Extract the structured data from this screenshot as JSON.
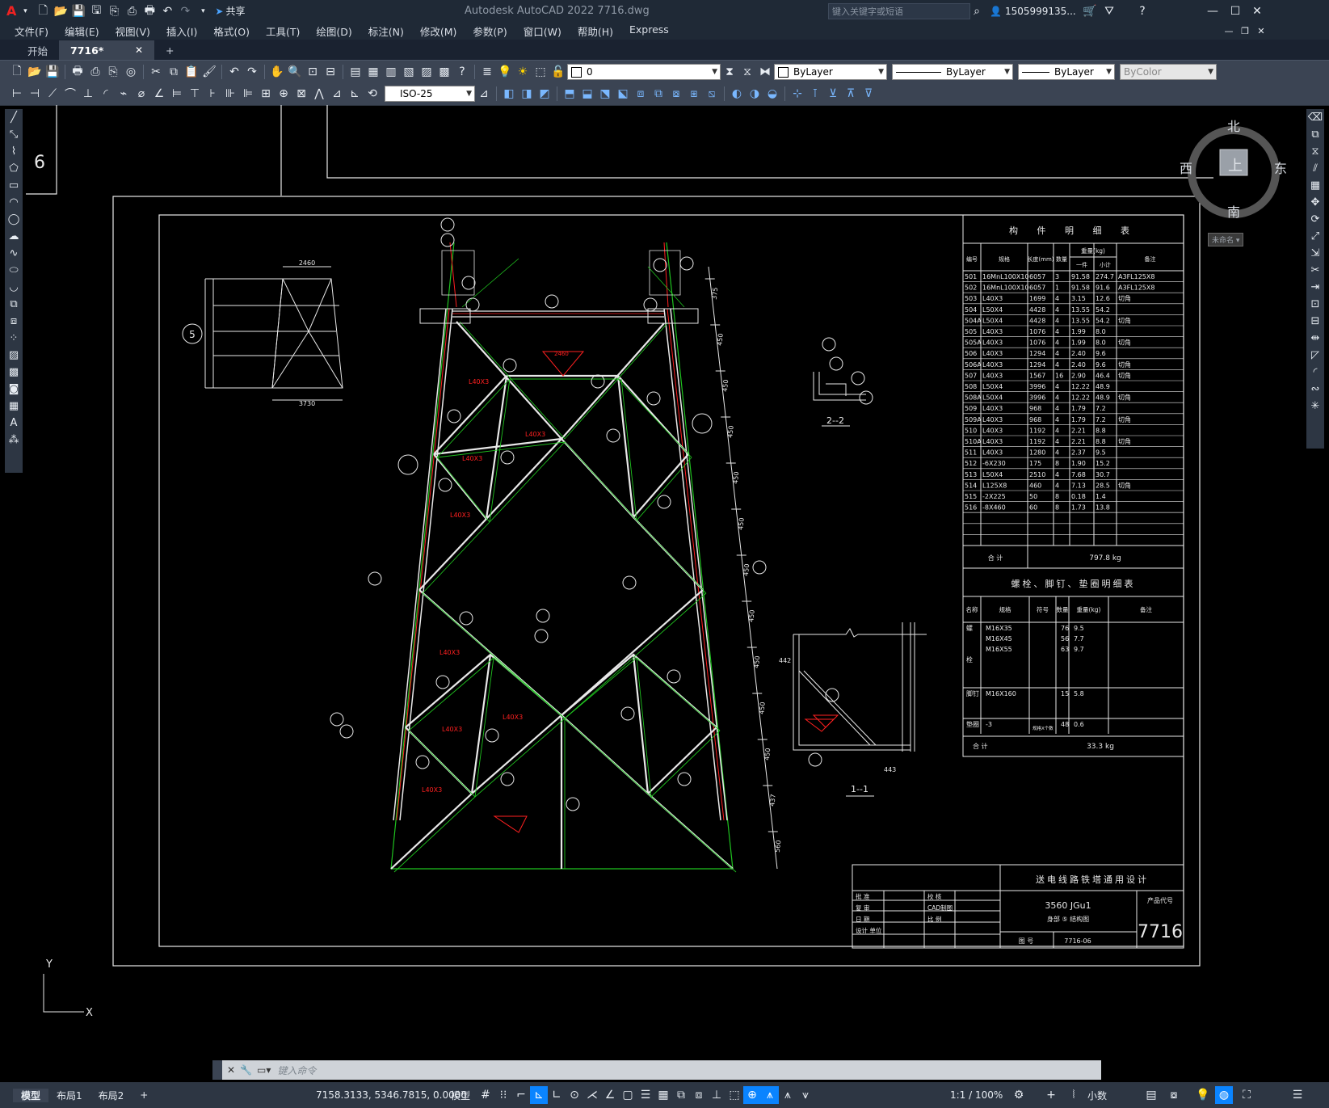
{
  "app": {
    "title": "Autodesk AutoCAD 2022   7716.dwg",
    "share_label": "共享",
    "search_placeholder": "键入关键字或短语",
    "user": "1505999135...",
    "colors": {
      "accent": "#0a84ff",
      "titlebar": "#1f2936",
      "canvas": "#000000",
      "red": "#ff2020",
      "green": "#1fc21f"
    }
  },
  "menu": [
    "文件(F)",
    "编辑(E)",
    "视图(V)",
    "插入(I)",
    "格式(O)",
    "工具(T)",
    "绘图(D)",
    "标注(N)",
    "修改(M)",
    "参数(P)",
    "窗口(W)",
    "帮助(H)",
    "Express"
  ],
  "tabs": {
    "start": "开始",
    "doc": "7716*",
    "add": "+"
  },
  "toolbar": {
    "layer_value": "0",
    "color_value": "ByLayer",
    "linetype_value": "ByLayer",
    "lineweight_value": "ByLayer",
    "plotstyle_value": "ByColor",
    "dimstyle_value": "ISO-25"
  },
  "viewcube": {
    "north": "北",
    "south": "南",
    "east": "东",
    "west": "西",
    "top": "上",
    "wcs": "未命名"
  },
  "ucs": {
    "x": "X",
    "y": "Y"
  },
  "command": {
    "placeholder": "键入命令"
  },
  "status": {
    "coords": "7158.3133, 5346.7815, 0.0000",
    "model_label": "模型",
    "layouts": [
      "模型",
      "布局1",
      "布局2"
    ],
    "scale": "1:1 / 100%",
    "units": "小数"
  },
  "drawing": {
    "detail5_label": "5",
    "detail5_width": "2460",
    "detail5_base": "3730",
    "detail5_heights": [
      "1500",
      "1500",
      "1500",
      "1500",
      "6000"
    ],
    "section22": "2--2",
    "section11": "1--1",
    "bom": {
      "title": "构 件 明 细 表",
      "headers": [
        "编号",
        "规格",
        "长度(mm)",
        "数量",
        "一件",
        "小计",
        "备注"
      ],
      "weight_header": "重量(kg)",
      "rows": [
        [
          "501",
          "16MnL100X10",
          "6057",
          "3",
          "91.58",
          "274.7",
          "A3FL125X8"
        ],
        [
          "502",
          "16MnL100X10",
          "6057",
          "1",
          "91.58",
          "91.6",
          "A3FL125X8"
        ],
        [
          "503",
          "L40X3",
          "1699",
          "4",
          "3.15",
          "12.6",
          "切角"
        ],
        [
          "504",
          "L50X4",
          "4428",
          "4",
          "13.55",
          "54.2",
          ""
        ],
        [
          "504A",
          "L50X4",
          "4428",
          "4",
          "13.55",
          "54.2",
          "切角"
        ],
        [
          "505",
          "L40X3",
          "1076",
          "4",
          "1.99",
          "8.0",
          ""
        ],
        [
          "505A",
          "L40X3",
          "1076",
          "4",
          "1.99",
          "8.0",
          "切角"
        ],
        [
          "506",
          "L40X3",
          "1294",
          "4",
          "2.40",
          "9.6",
          ""
        ],
        [
          "506A",
          "L40X3",
          "1294",
          "4",
          "2.40",
          "9.6",
          "切角"
        ],
        [
          "507",
          "L40X3",
          "1567",
          "16",
          "2.90",
          "46.4",
          "切角"
        ],
        [
          "508",
          "L50X4",
          "3996",
          "4",
          "12.22",
          "48.9",
          ""
        ],
        [
          "508A",
          "L50X4",
          "3996",
          "4",
          "12.22",
          "48.9",
          "切角"
        ],
        [
          "509",
          "L40X3",
          "968",
          "4",
          "1.79",
          "7.2",
          ""
        ],
        [
          "509A",
          "L40X3",
          "968",
          "4",
          "1.79",
          "7.2",
          "切角"
        ],
        [
          "510",
          "L40X3",
          "1192",
          "4",
          "2.21",
          "8.8",
          ""
        ],
        [
          "510A",
          "L40X3",
          "1192",
          "4",
          "2.21",
          "8.8",
          "切角"
        ],
        [
          "511",
          "L40X3",
          "1280",
          "4",
          "2.37",
          "9.5",
          ""
        ],
        [
          "512",
          "-6X230",
          "175",
          "8",
          "1.90",
          "15.2",
          ""
        ],
        [
          "513",
          "L50X4",
          "2510",
          "4",
          "7.68",
          "30.7",
          ""
        ],
        [
          "514",
          "L125X8",
          "460",
          "4",
          "7.13",
          "28.5",
          "切角"
        ],
        [
          "515",
          "-2X225",
          "50",
          "8",
          "0.18",
          "1.4",
          ""
        ],
        [
          "516",
          "-8X460",
          "60",
          "8",
          "1.73",
          "13.8",
          ""
        ]
      ],
      "total_label": "合 计",
      "total": "797.8 kg"
    },
    "bolt_table": {
      "title": "螺栓、脚钉、垫圈明细表",
      "headers": [
        "名称",
        "规格",
        "符号",
        "数量",
        "重量(kg)",
        "备注"
      ],
      "rows": [
        [
          "螺",
          "M16X35",
          "",
          "76",
          "9.5",
          ""
        ],
        [
          "",
          "M16X45",
          "",
          "56",
          "7.7",
          ""
        ],
        [
          "",
          "M16X55",
          "",
          "63",
          "9.7",
          ""
        ],
        [
          "栓",
          "",
          "",
          "",
          "",
          ""
        ],
        [
          "脚钉",
          "M16X160",
          "",
          "15",
          "5.8",
          ""
        ],
        [
          "垫圈",
          "-3",
          "",
          "48",
          "0.6",
          ""
        ]
      ],
      "washer_note": "规格X个数",
      "total_label": "合 计",
      "total": "33.3 kg"
    },
    "title_block": {
      "project": "送电线路铁塔通用设计",
      "drawing_name": "3560 JGu1",
      "subtitle": "身部 ⑤ 结构图",
      "product_code_label": "产品代号",
      "product_code": "7716",
      "drawing_no_label": "图 号",
      "drawing_no": "7716-06",
      "rows_left": [
        "批 准",
        "复 审",
        "日 期",
        "设计 单位"
      ],
      "rows_mid": [
        "校 核",
        "CAD制图",
        "比 例"
      ]
    },
    "dims_right": [
      "375",
      "450",
      "450",
      "450",
      "450",
      "450",
      "450",
      "450",
      "450",
      "450",
      "450",
      "437",
      "560"
    ],
    "dim_top": "L50X4 2510",
    "dim_bottom": "1865",
    "dim_11": "443",
    "dim_11b": "442"
  }
}
